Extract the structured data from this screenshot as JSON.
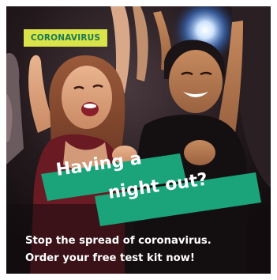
{
  "badge": {
    "label": "CORONAVIRUS"
  },
  "headline": {
    "line1": "Having a",
    "line2": "night out?"
  },
  "body": {
    "line1": "Stop the spread of coronavirus.",
    "line2": "Order your free test kit now!"
  },
  "colors": {
    "badge_bg": "#d9e34a",
    "badge_text": "#1a7a52",
    "banner": "#1ba37a",
    "background": "#1a1416"
  }
}
